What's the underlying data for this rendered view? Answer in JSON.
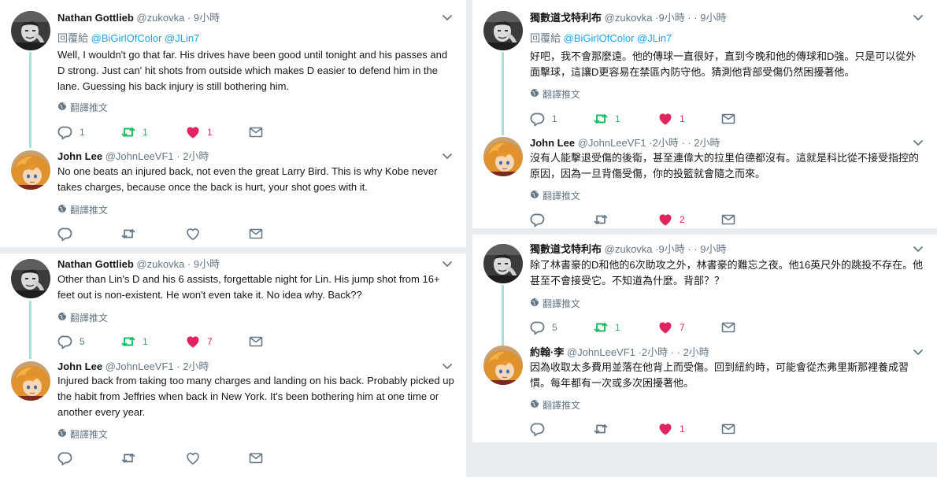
{
  "ui": {
    "translate_label": "翻譯推文",
    "colors": {
      "retweet_green": "#17bf63",
      "like_red": "#e0245e",
      "link_blue": "#1da1f2",
      "thread_line": "#a9e1d5",
      "meta_gray": "#657786"
    }
  },
  "left": [
    {
      "name": "Nathan Gottlieb",
      "handle": "@zukovka",
      "time": "· 9小時",
      "reply_prefix": "回覆給",
      "mentions": "@BiGirlOfColor @JLin7",
      "text": "Well, I wouldn't go that far. His drives have been good until tonight and his passes and D strong. Just can' hit shots from outside which makes D easier to defend him in the lane. Guessing his back injury is still bothering him.",
      "replies": "1",
      "retweets": "1",
      "likes": "1",
      "avatar_icon": "avatar-photo-icon"
    },
    {
      "name": "John Lee",
      "handle": "@JohnLeeVF1",
      "time": "· 2小時",
      "text": "No one beats an injured back, not even the great Larry Bird.  This is why Kobe never takes charges, because once the back is hurt, your shot goes with it.",
      "replies": "",
      "retweets": "",
      "likes": "",
      "avatar_icon": "avatar-anime-icon"
    },
    {
      "name": "Nathan Gottlieb",
      "handle": "@zukovka",
      "time": "· 9小時",
      "text": "Other than Lin's D and his 6 assists, forgettable night for Lin. His jump shot from 16+ feet out is non-existent. He won't even take it. No idea why. Back??",
      "replies": "5",
      "retweets": "1",
      "likes": "7",
      "avatar_icon": "avatar-photo-icon"
    },
    {
      "name": "John Lee",
      "handle": "@JohnLeeVF1",
      "time": "· 2小時",
      "text": "Injured back from taking too many charges and landing on his back.  Probably picked up the habit from Jeffries when back in New York.  It's been bothering him at one time or another every year.",
      "replies": "",
      "retweets": "",
      "likes": "",
      "avatar_icon": "avatar-anime-icon"
    }
  ],
  "right": [
    {
      "name": "獨數道戈特利布",
      "handle": "@zukovka",
      "time": "·9小時 · · 9小時",
      "reply_prefix": "回覆給",
      "mentions": "@BiGirlOfColor @JLin7",
      "text": "好吧，我不會那麼遠。他的傳球一直很好，直到今晚和他的傳球和D強。只是可以從外面擊球，這讓D更容易在禁區內防守他。猜測他背部受傷仍然困擾著他。",
      "replies": "1",
      "retweets": "1",
      "likes": "1",
      "avatar_icon": "avatar-photo-icon"
    },
    {
      "name": "John Lee",
      "handle": "@JohnLeeVF1",
      "time": "·2小時 · · 2小時",
      "text": "沒有人能擊退受傷的後衛，甚至連偉大的拉里伯德都沒有。這就是科比從不接受指控的原因，因為一旦背傷受傷，你的投籃就會隨之而來。",
      "replies": "",
      "retweets": "",
      "likes": "2",
      "avatar_icon": "avatar-anime-icon"
    },
    {
      "name": "獨數道戈特利布",
      "handle": "@zukovka",
      "time": "·9小時 · · 9小時",
      "text": "除了林書豪的D和他的6次助攻之外，林書豪的難忘之夜。他16英尺外的跳投不存在。他甚至不會接受它。不知道為什麼。背部？？",
      "replies": "5",
      "retweets": "1",
      "likes": "7",
      "avatar_icon": "avatar-photo-icon"
    },
    {
      "name": "約翰·李",
      "handle": "@JohnLeeVF1",
      "time": "·2小時 · · 2小時",
      "text": "因為收取太多費用並落在他背上而受傷。回到紐約時，可能會從杰弗里斯那裡養成習慣。每年都有一次或多次困擾著他。",
      "replies": "",
      "retweets": "",
      "likes": "1",
      "avatar_icon": "avatar-anime-icon"
    }
  ]
}
